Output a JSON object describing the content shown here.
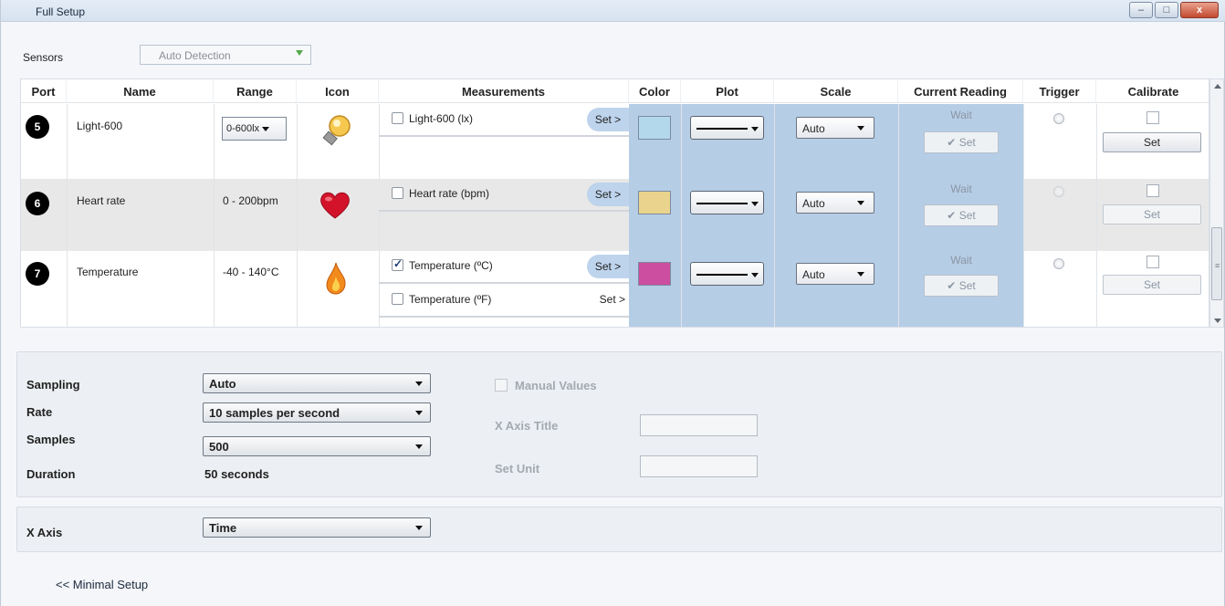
{
  "window": {
    "title": "Full Setup",
    "buttons": {
      "minimize": "–",
      "maximize": "□",
      "close": "x"
    }
  },
  "sensors": {
    "label": "Sensors",
    "value": "Auto Detection"
  },
  "table": {
    "headers": [
      "Port",
      "Name",
      "Range",
      "Icon",
      "Measurements",
      "Color",
      "Plot",
      "Scale",
      "Current Reading",
      "Trigger",
      "Calibrate"
    ],
    "rows": [
      {
        "port": "5",
        "name": "Light-600",
        "range": "0-600lx",
        "icon": "light-bulb-icon",
        "measurements": [
          {
            "label": "Light-600 (lx)",
            "checked": false,
            "set": "Set >"
          }
        ],
        "color": "#b3d8ec",
        "scale": "Auto",
        "reading": "Wait",
        "reading_set": "Set",
        "calibrate_set": "Set"
      },
      {
        "port": "6",
        "name": "Heart rate",
        "range": "0 - 200bpm",
        "icon": "heart-icon",
        "measurements": [
          {
            "label": "Heart rate (bpm)",
            "checked": false,
            "set": "Set >"
          }
        ],
        "color": "#ead38c",
        "scale": "Auto",
        "reading": "Wait",
        "reading_set": "Set",
        "calibrate_set": "Set"
      },
      {
        "port": "7",
        "name": "Temperature",
        "range": "-40 - 140°C",
        "icon": "flame-icon",
        "measurements": [
          {
            "label": "Temperature (ºC)",
            "checked": true,
            "set": "Set >"
          },
          {
            "label": "Temperature (ºF)",
            "checked": false,
            "set": "Set >"
          }
        ],
        "color": "#cc4ea1",
        "scale": "Auto",
        "reading": "Wait",
        "reading_set": "Set",
        "calibrate_set": "Set"
      }
    ]
  },
  "sampling": {
    "sampling_label": "Sampling",
    "sampling_value": "Auto",
    "rate_label": "Rate",
    "rate_value": "10 samples per second",
    "samples_label": "Samples",
    "samples_value": "500",
    "duration_label": "Duration",
    "duration_value": "50 seconds",
    "manual_values_label": "Manual Values",
    "x_axis_title_label": "X Axis Title",
    "set_unit_label": "Set Unit"
  },
  "xaxis": {
    "label": "X Axis",
    "value": "Time"
  },
  "footer": {
    "minimal_setup": "<< Minimal Setup"
  }
}
